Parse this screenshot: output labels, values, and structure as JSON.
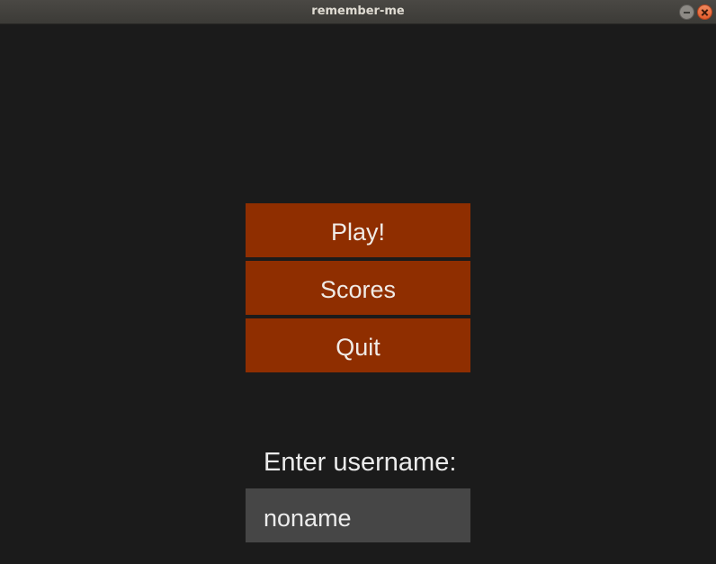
{
  "window": {
    "title": "remember-me"
  },
  "menu": {
    "play_label": "Play!",
    "scores_label": "Scores",
    "quit_label": "Quit"
  },
  "login": {
    "prompt": "Enter username:",
    "username_value": "noname"
  },
  "colors": {
    "background": "#1b1b1b",
    "button": "#8f2e00",
    "input": "#464646",
    "text": "#f0ebe6"
  },
  "icons": {
    "minimize": "minimize-icon",
    "close": "close-icon"
  }
}
